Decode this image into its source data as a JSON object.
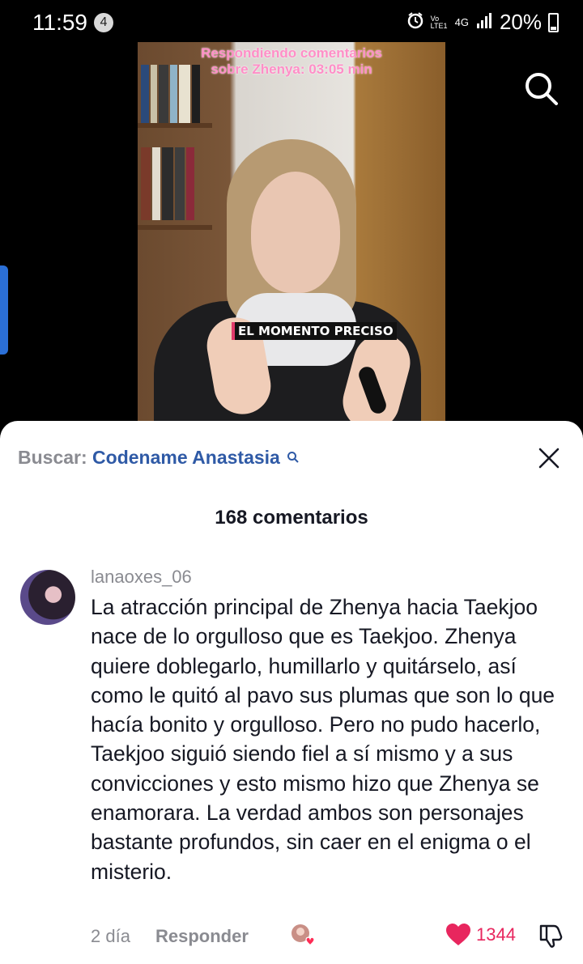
{
  "status_bar": {
    "time": "11:59",
    "notification_count": "4",
    "network": "4G",
    "volte": "Vo LTE1",
    "battery": "20%"
  },
  "video": {
    "caption_line1": "Respondiendo comentarios",
    "caption_line2": "sobre Zhenya: 03:05 min",
    "overlay_label": "EL MOMENTO PRECISO"
  },
  "comments_sheet": {
    "search_prefix": "Buscar:",
    "search_term": "Codename Anastasia",
    "count_label": "168 comentarios"
  },
  "comment": {
    "username": "lanaoxes_06",
    "text": "La atracción principal de Zhenya hacia Taekjoo nace de lo orgulloso que es Taekjoo. Zhenya quiere doblegarlo, humillarlo y quitárselo, así como le quitó al pavo sus plumas que son lo que hacía bonito y orgulloso. Pero no pudo hacerlo, Taekjoo siguió siendo fiel a sí mismo y a sus convicciones y esto mismo hizo que Zhenya se enamorara. La verdad ambos son personajes bastante profundos, sin caer en el enigma o el misterio.",
    "date": "2 día",
    "reply_label": "Responder",
    "like_count": "1344"
  },
  "colors": {
    "accent_blue": "#2f5aa6",
    "like_red": "#e8265e",
    "muted_text": "#8a8b91"
  },
  "icons": [
    "alarm-icon",
    "signal-icon",
    "battery-icon",
    "search-icon",
    "close-icon",
    "heart-icon",
    "dislike-icon",
    "creator-liked-icon"
  ]
}
